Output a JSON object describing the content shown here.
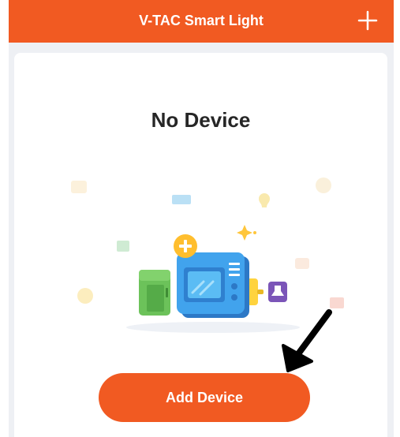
{
  "header": {
    "title": "V-TAC Smart Light",
    "add_icon": "plus-icon"
  },
  "empty_state": {
    "message": "No Device",
    "illustration_icon": "smart-devices-illustration"
  },
  "actions": {
    "add_device_label": "Add Device"
  },
  "annotation": {
    "arrow_icon": "arrow-pointer-icon"
  },
  "colors": {
    "accent": "#f15a22",
    "background": "#eef0f4",
    "card": "#ffffff",
    "text": "#262626"
  }
}
